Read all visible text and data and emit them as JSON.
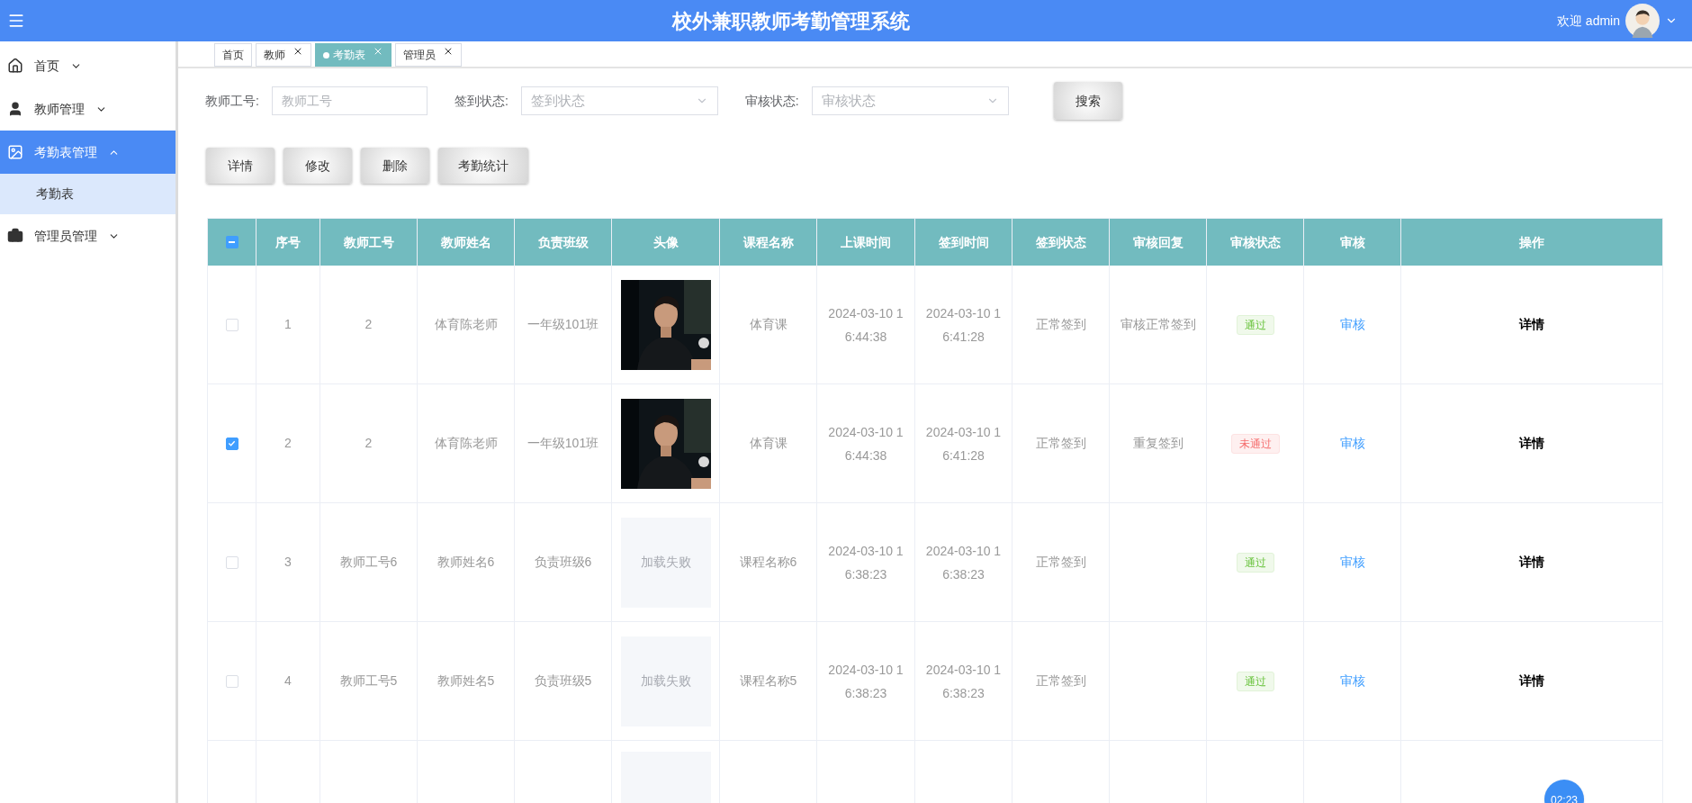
{
  "header": {
    "title": "校外兼职教师考勤管理系统",
    "welcome": "欢迎 admin"
  },
  "sidebar": {
    "items": [
      {
        "label": "首页",
        "expanded": false,
        "selected": false
      },
      {
        "label": "教师管理",
        "expanded": false,
        "selected": false
      },
      {
        "label": "考勤表管理",
        "expanded": true,
        "selected": true,
        "children": [
          {
            "label": "考勤表",
            "selected": true
          }
        ]
      },
      {
        "label": "管理员管理",
        "expanded": false,
        "selected": false
      }
    ]
  },
  "tabs": [
    {
      "label": "首页",
      "closable": false,
      "selected": false
    },
    {
      "label": "教师",
      "closable": true,
      "selected": false
    },
    {
      "label": "考勤表",
      "closable": true,
      "selected": true
    },
    {
      "label": "管理员",
      "closable": true,
      "selected": false
    }
  ],
  "filters": [
    {
      "kind": "input",
      "label": "教师工号:",
      "placeholder": "教师工号"
    },
    {
      "kind": "select",
      "label": "签到状态:",
      "placeholder": "签到状态"
    },
    {
      "kind": "select",
      "label": "审核状态:",
      "placeholder": "审核状态"
    }
  ],
  "search_button": "搜索",
  "actions": [
    "详情",
    "修改",
    "删除",
    "考勤统计"
  ],
  "table": {
    "select_all_indeterminate": true,
    "columns": [
      "序号",
      "教师工号",
      "教师姓名",
      "负责班级",
      "头像",
      "课程名称",
      "上课时间",
      "签到时间",
      "签到状态",
      "审核回复",
      "审核状态",
      "审核",
      "操作"
    ],
    "rows": [
      {
        "selected": false,
        "no": "1",
        "teacher_id": "2",
        "teacher_name": "体育陈老师",
        "class": "一年级101班",
        "course": "体育课",
        "class_time": "2024-03-10 16:44:38",
        "checkin_time": "2024-03-10 16:41:28",
        "checkin_status": "正常签到",
        "review_reply": "审核正常签到",
        "review_status": {
          "text": "通过",
          "kind": "pass"
        },
        "review_link": "审核",
        "operation": "详情"
      },
      {
        "selected": true,
        "no": "2",
        "teacher_id": "2",
        "teacher_name": "体育陈老师",
        "class": "一年级101班",
        "course": "体育课",
        "class_time": "2024-03-10 16:44:38",
        "checkin_time": "2024-03-10 16:41:28",
        "checkin_status": "正常签到",
        "review_reply": "重复签到",
        "review_status": {
          "text": "未通过",
          "kind": "fail"
        },
        "review_link": "审核",
        "operation": "详情"
      },
      {
        "selected": false,
        "no": "3",
        "teacher_id": "教师工号6",
        "teacher_name": "教师姓名6",
        "class": "负责班级6",
        "avatar": {
          "kind": "failed",
          "text": "加载失败"
        },
        "course": "课程名称6",
        "class_time": "2024-03-10 16:38:23",
        "checkin_time": "2024-03-10 16:38:23",
        "checkin_status": "正常签到",
        "review_status": {
          "text": "通过",
          "kind": "pass"
        },
        "review_link": "审核",
        "operation": "详情"
      },
      {
        "selected": false,
        "no": "4",
        "teacher_id": "教师工号5",
        "teacher_name": "教师姓名5",
        "class": "负责班级5",
        "avatar": {
          "kind": "failed",
          "text": "加载失败"
        },
        "course": "课程名称5",
        "class_time": "2024-03-10 16:38:23",
        "checkin_time": "2024-03-10 16:38:23",
        "checkin_status": "正常签到",
        "review_status": {
          "text": "通过",
          "kind": "pass"
        },
        "review_link": "审核",
        "operation": "详情"
      }
    ]
  },
  "timer_badge": "02:23"
}
